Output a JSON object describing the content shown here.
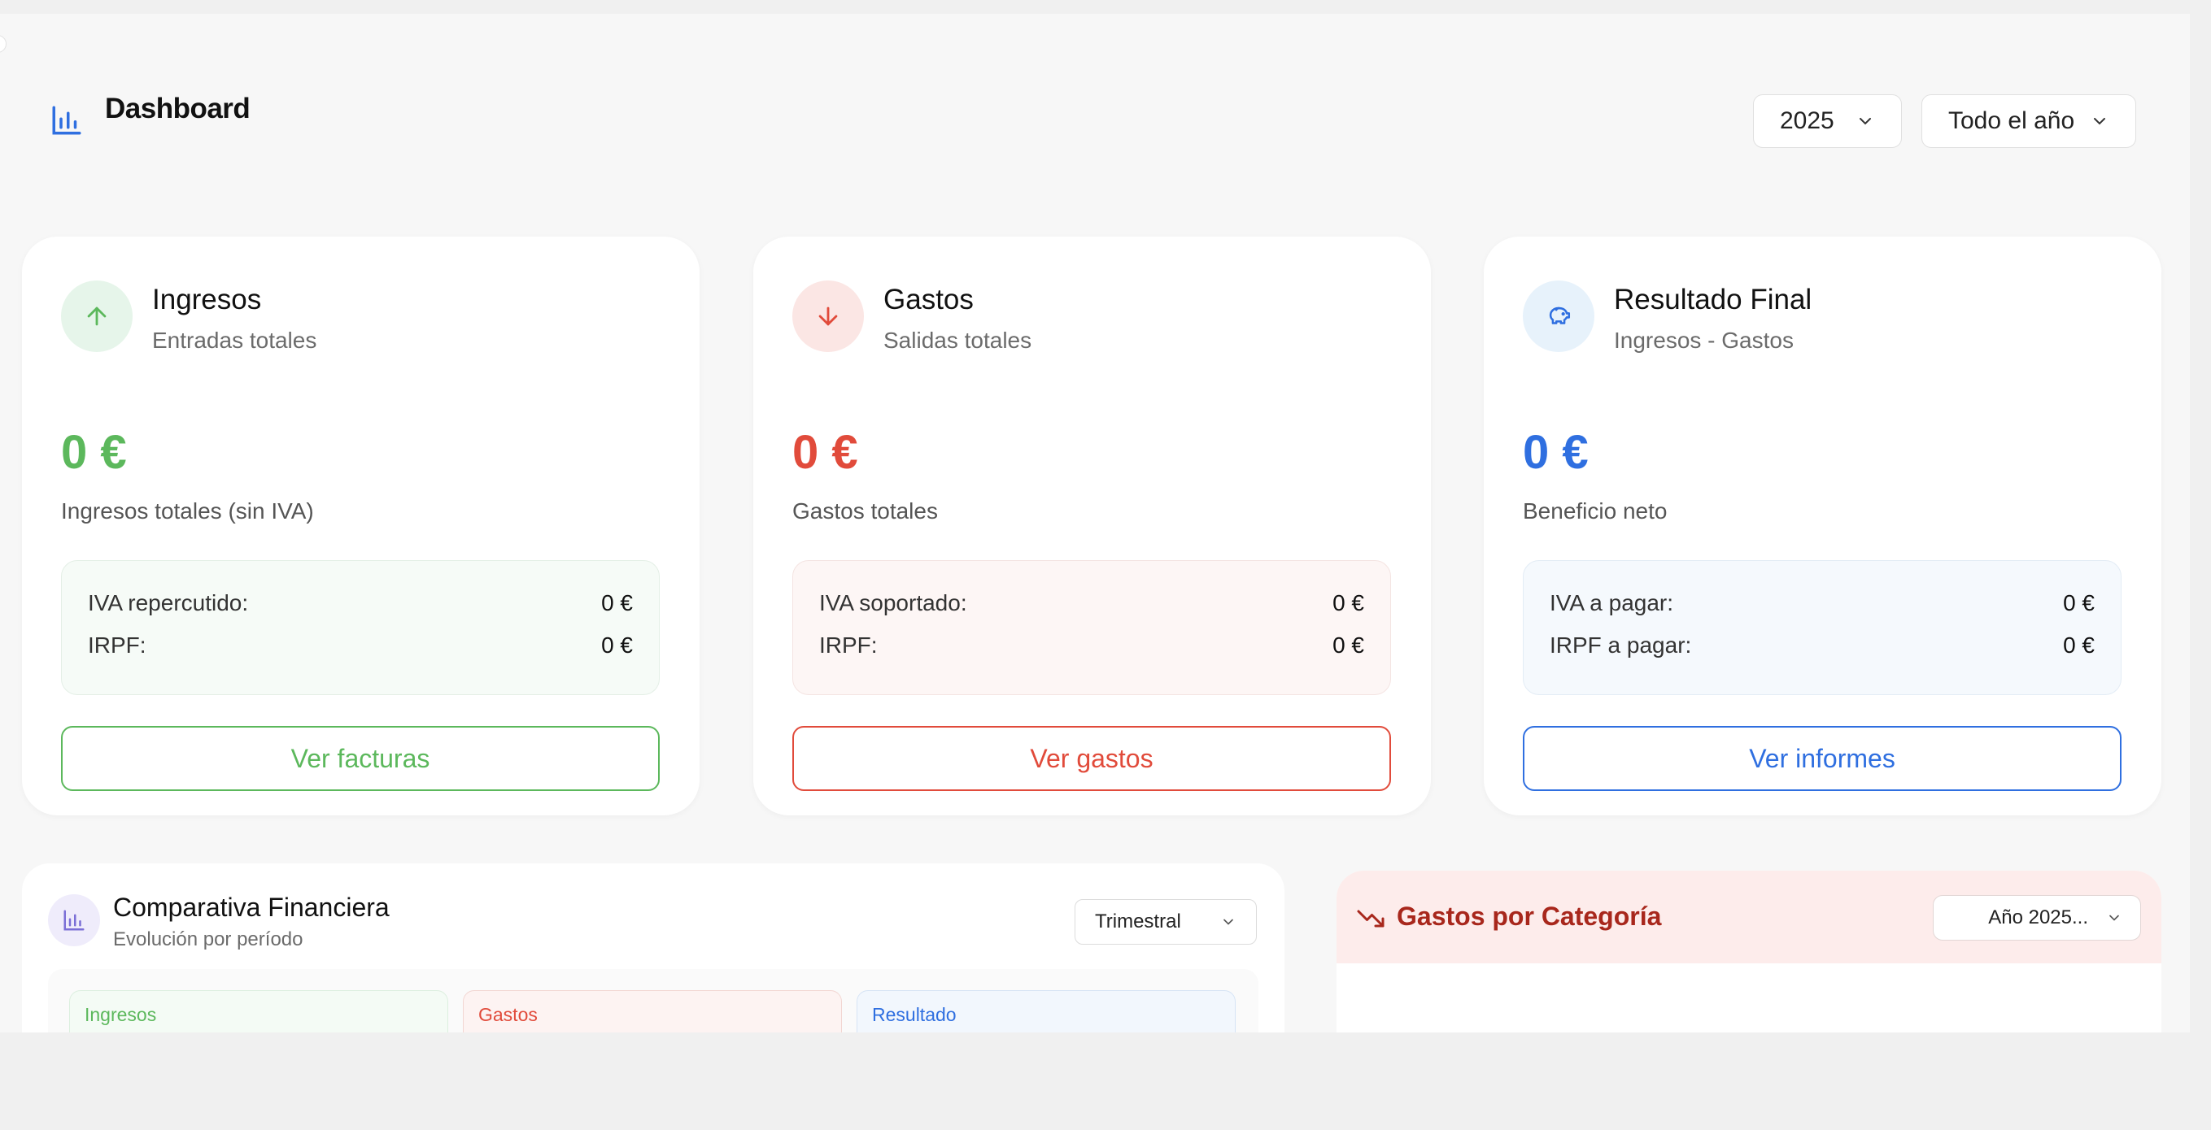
{
  "header": {
    "title": "Dashboard",
    "year_select": "2025",
    "period_select": "Todo el año"
  },
  "cards": [
    {
      "title": "Ingresos",
      "subtitle": "Entradas totales",
      "amount": "0 €",
      "amount_label": "Ingresos totales (sin IVA)",
      "rows": [
        {
          "label": "IVA repercutido:",
          "value": "0 €"
        },
        {
          "label": "IRPF:",
          "value": "0 €"
        }
      ],
      "button": "Ver facturas",
      "icon": "arrow-up-icon",
      "color": "#5cb85c"
    },
    {
      "title": "Gastos",
      "subtitle": "Salidas totales",
      "amount": "0 €",
      "amount_label": "Gastos totales",
      "rows": [
        {
          "label": "IVA soportado:",
          "value": "0 €"
        },
        {
          "label": "IRPF:",
          "value": "0 €"
        }
      ],
      "button": "Ver gastos",
      "icon": "arrow-down-icon",
      "color": "#e14b3b"
    },
    {
      "title": "Resultado Final",
      "subtitle": "Ingresos - Gastos",
      "amount": "0 €",
      "amount_label": "Beneficio neto",
      "rows": [
        {
          "label": "IVA a pagar:",
          "value": "0 €"
        },
        {
          "label": "IRPF a pagar:",
          "value": "0 €"
        }
      ],
      "button": "Ver informes",
      "icon": "piggy-bank-icon",
      "color": "#2f6fe0"
    }
  ],
  "comparativa": {
    "title": "Comparativa Financiera",
    "subtitle": "Evolución por período",
    "select": "Trimestral",
    "mini_cards": [
      "Ingresos",
      "Gastos",
      "Resultado"
    ]
  },
  "categoria": {
    "title": "Gastos por Categoría",
    "select": "Año 2025..."
  }
}
